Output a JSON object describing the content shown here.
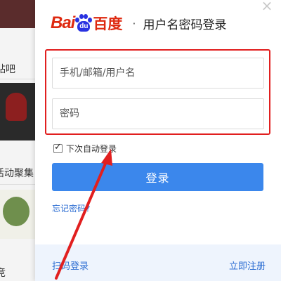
{
  "background": {
    "texts": [
      "贴吧",
      "活动聚集",
      "竞"
    ]
  },
  "dialog": {
    "close_symbol": "×",
    "logo": {
      "bai": "Bai",
      "du": "du",
      "cn": "百度"
    },
    "header_separator": "·",
    "title": "用户名密码登录",
    "username": {
      "placeholder": "手机/邮箱/用户名",
      "value": ""
    },
    "password": {
      "placeholder": "密码",
      "value": ""
    },
    "remember": {
      "label": "下次自动登录",
      "checked": true
    },
    "login_label": "登录",
    "forgot_label": "忘记密码?",
    "footer": {
      "qr_label": "扫码登录",
      "register_label": "立即注册"
    }
  },
  "colors": {
    "brand_red": "#de2910",
    "brand_blue": "#2932e1",
    "button_blue": "#3b87ec",
    "link_blue": "#2c6dd2",
    "highlight_red": "#e11f1f"
  }
}
